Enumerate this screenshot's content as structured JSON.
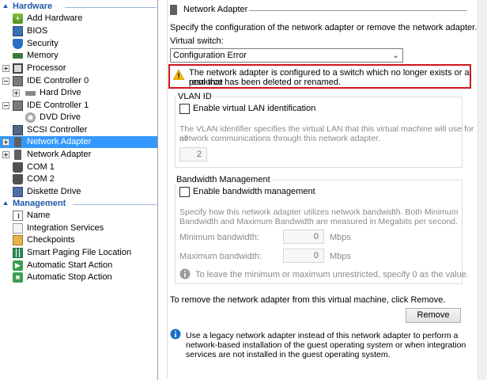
{
  "tree": {
    "hardware_header": "Hardware",
    "management_header": "Management",
    "hardware_items": [
      {
        "label": "Add Hardware",
        "icon": "add-hardware-icon"
      },
      {
        "label": "BIOS",
        "icon": "bios-icon"
      },
      {
        "label": "Security",
        "icon": "shield-icon"
      },
      {
        "label": "Memory",
        "icon": "memory-icon"
      },
      {
        "label": "Processor",
        "icon": "processor-icon"
      },
      {
        "label": "IDE Controller 0",
        "icon": "ide-controller-icon"
      },
      {
        "label": "Hard Drive",
        "icon": "hard-drive-icon"
      },
      {
        "label": "IDE Controller 1",
        "icon": "ide-controller-icon"
      },
      {
        "label": "DVD Drive",
        "icon": "dvd-drive-icon"
      },
      {
        "label": "SCSI Controller",
        "icon": "scsi-controller-icon"
      },
      {
        "label": "Network Adapter",
        "icon": "network-adapter-icon",
        "selected": true
      },
      {
        "label": "Network Adapter",
        "icon": "network-adapter-icon"
      },
      {
        "label": "COM 1",
        "icon": "com-port-icon"
      },
      {
        "label": "COM 2",
        "icon": "com-port-icon"
      },
      {
        "label": "Diskette Drive",
        "icon": "diskette-drive-icon"
      }
    ],
    "management_items": [
      {
        "label": "Name",
        "icon": "name-icon"
      },
      {
        "label": "Integration Services",
        "icon": "integration-services-icon"
      },
      {
        "label": "Checkpoints",
        "icon": "checkpoints-icon"
      },
      {
        "label": "Smart Paging File Location",
        "icon": "smart-paging-icon"
      },
      {
        "label": "Automatic Start Action",
        "icon": "automatic-start-icon"
      },
      {
        "label": "Automatic Stop Action",
        "icon": "automatic-stop-icon"
      }
    ]
  },
  "panel": {
    "title": "Network Adapter",
    "description": "Specify the configuration of the network adapter or remove the network adapter.",
    "virtual_switch_label": "Virtual switch:",
    "virtual_switch_value": "Configuration Error",
    "warning_line1": "The network adapter is configured to a switch which no longer exists or a resource",
    "warning_line2": "pool that has been deleted or renamed.",
    "vlan": {
      "title": "VLAN ID",
      "checkbox_label": "Enable virtual LAN identification",
      "help_line1": "The VLAN identifier specifies the virtual LAN that this virtual machine will use for all",
      "help_line2": "network communications through this network adapter.",
      "value": "2"
    },
    "bandwidth": {
      "title": "Bandwidth Management",
      "checkbox_label": "Enable bandwidth management",
      "help_line1": "Specify how this network adapter utilizes network bandwidth. Both Minimum",
      "help_line2": "Bandwidth and Maximum Bandwidth are measured in Megabits per second.",
      "min_label": "Minimum bandwidth:",
      "min_value": "0",
      "max_label": "Maximum bandwidth:",
      "max_value": "0",
      "unit": "Mbps",
      "info_text": "To leave the minimum or maximum unrestricted, specify 0 as the value."
    },
    "remove_text": "To remove the network adapter from this virtual machine, click Remove.",
    "remove_button": "Remove",
    "legacy_line1": "Use a legacy network adapter instead of this network adapter to perform a",
    "legacy_line2": "network-based installation of the guest operating system or when integration",
    "legacy_line3": "services are not installed in the guest operating system."
  },
  "colors": {
    "selection": "#3399ff",
    "section_header": "#1e5aa8",
    "warning_border": "#d0141c",
    "info_icon": "#1e6fc4",
    "warning_icon": "#f5b800"
  }
}
